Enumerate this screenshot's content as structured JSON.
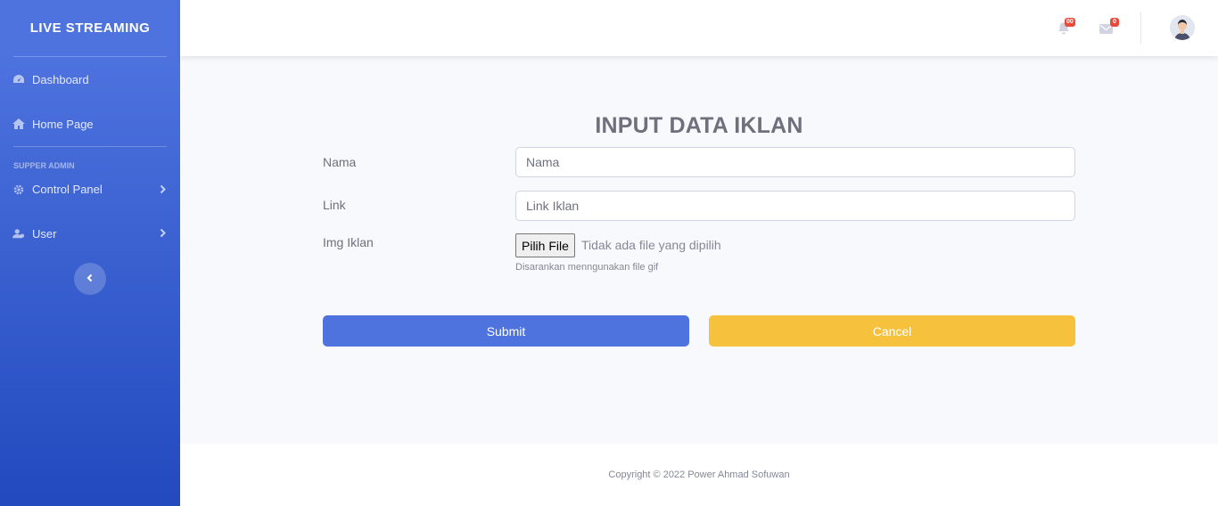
{
  "sidebar": {
    "brand": "LIVE STREAMING",
    "items": [
      {
        "label": "Dashboard",
        "icon": "dashboard-icon"
      },
      {
        "label": "Home Page",
        "icon": "home-icon"
      }
    ],
    "section_heading": "SUPPER ADMIN",
    "section_items": [
      {
        "label": "Control Panel",
        "icon": "gear-icon"
      },
      {
        "label": "User",
        "icon": "users-icon"
      }
    ]
  },
  "topbar": {
    "alerts_count": "00",
    "messages_count": "0"
  },
  "main": {
    "title": "INPUT DATA IKLAN",
    "fields": {
      "nama": {
        "label": "Nama",
        "placeholder": "Nama",
        "value": ""
      },
      "link": {
        "label": "Link",
        "placeholder": "Link Iklan",
        "value": ""
      },
      "img": {
        "label": "Img Iklan",
        "button_label": "Pilih File",
        "status": "Tidak ada file yang dipilih",
        "help": "Disarankan menngunakan file gif"
      }
    },
    "submit_label": "Submit",
    "cancel_label": "Cancel"
  },
  "footer": {
    "copyright": "Copyright © 2022 Power Ahmad Sofuwan"
  },
  "colors": {
    "primary": "#4e73df",
    "warning": "#f6c23e",
    "danger": "#e74a3b"
  }
}
